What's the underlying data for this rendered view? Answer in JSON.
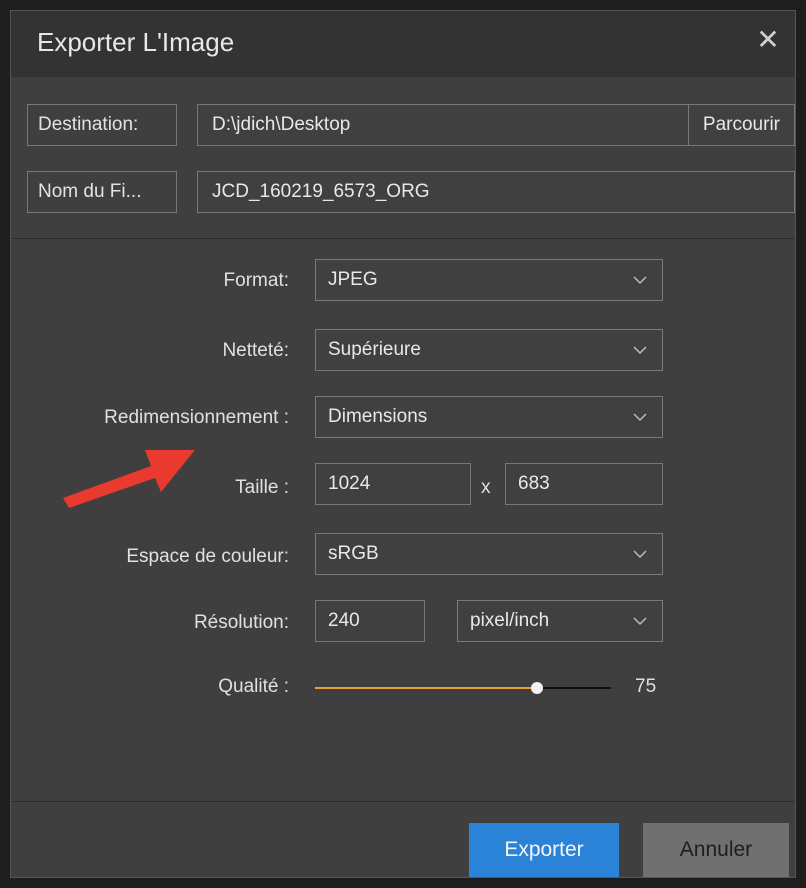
{
  "dialog": {
    "title": "Exporter L'Image",
    "close_glyph": "✕"
  },
  "destination": {
    "label": "Destination:",
    "value": "D:\\jdich\\Desktop",
    "browse_label": "Parcourir"
  },
  "filename": {
    "label": "Nom du Fi...",
    "value": "JCD_160219_6573_ORG"
  },
  "settings": {
    "format": {
      "label": "Format:",
      "value": "JPEG"
    },
    "sharpness": {
      "label": "Netteté:",
      "value": "Supérieure"
    },
    "resize": {
      "label": "Redimensionnement :",
      "value": "Dimensions"
    },
    "size": {
      "label": "Taille :",
      "width": "1024",
      "separator": "x",
      "height": "683"
    },
    "colorspace": {
      "label": "Espace de couleur:",
      "value": "sRGB"
    },
    "resolution": {
      "label": "Résolution:",
      "value": "240",
      "unit": "pixel/inch"
    },
    "quality": {
      "label": "Qualité :",
      "value": "75",
      "fraction": 0.75
    }
  },
  "footer": {
    "export_label": "Exporter",
    "cancel_label": "Annuler"
  },
  "colors": {
    "accent": "#2b83d8",
    "slider_fill": "#e8a030",
    "annotation_arrow": "#e83a2e"
  }
}
